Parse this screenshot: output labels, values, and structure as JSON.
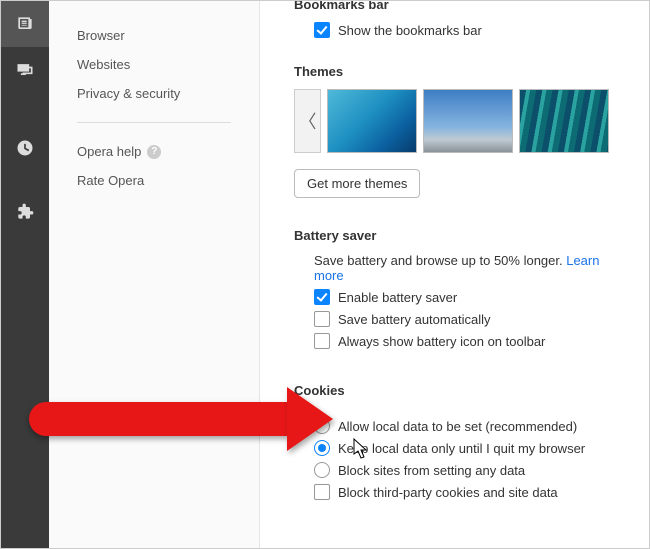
{
  "rail": {
    "icons": [
      "news",
      "screens",
      "clock",
      "extensions"
    ]
  },
  "sidebar": {
    "items": [
      {
        "label": "Browser"
      },
      {
        "label": "Websites"
      },
      {
        "label": "Privacy & security"
      }
    ],
    "help_label": "Opera help",
    "rate_label": "Rate Opera"
  },
  "bookmarks": {
    "title": "Bookmarks bar",
    "show_label": "Show the bookmarks bar",
    "show_checked": true
  },
  "themes": {
    "title": "Themes",
    "more_button": "Get more themes"
  },
  "battery": {
    "title": "Battery saver",
    "desc": "Save battery and browse up to 50% longer. ",
    "learn_more": "Learn more",
    "enable_label": "Enable battery saver",
    "enable_checked": true,
    "auto_label": "Save battery automatically",
    "auto_checked": false,
    "icon_label": "Always show battery icon on toolbar",
    "icon_checked": false
  },
  "cookies": {
    "title": "Cookies",
    "options": [
      {
        "label": "Allow local data to be set (recommended)",
        "checked": false
      },
      {
        "label": "Keep local data only until I quit my browser",
        "checked": true
      },
      {
        "label": "Block sites from setting any data",
        "checked": false
      }
    ],
    "third_party_label": "Block third-party cookies and site data",
    "third_party_checked": false
  }
}
